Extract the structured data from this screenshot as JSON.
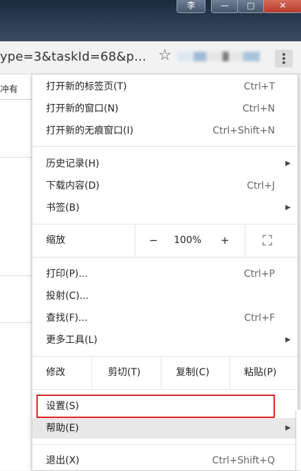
{
  "window": {
    "user_badge": "李",
    "minimize": "—",
    "maximize": "□",
    "close": "✕"
  },
  "toolbar": {
    "url": "ype=3&taskId=68&p...",
    "bookmark_icon": "star-icon",
    "menu_icon": "more-vert-icon"
  },
  "page": {
    "tab_text": "冲有"
  },
  "menu": {
    "new_tab": {
      "label": "打开新的标签页(T)",
      "shortcut": "Ctrl+T"
    },
    "new_window": {
      "label": "打开新的窗口(N)",
      "shortcut": "Ctrl+N"
    },
    "incognito": {
      "label": "打开新的无痕窗口(I)",
      "shortcut": "Ctrl+Shift+N"
    },
    "history": {
      "label": "历史记录(H)"
    },
    "downloads": {
      "label": "下载内容(D)",
      "shortcut": "Ctrl+J"
    },
    "bookmarks": {
      "label": "书签(B)"
    },
    "zoom": {
      "label": "缩放",
      "minus": "−",
      "value": "100%",
      "plus": "+",
      "fullscreen": "⛶"
    },
    "print": {
      "label": "打印(P)...",
      "shortcut": "Ctrl+P"
    },
    "cast": {
      "label": "投射(C)..."
    },
    "find": {
      "label": "查找(F)...",
      "shortcut": "Ctrl+F"
    },
    "more_tools": {
      "label": "更多工具(L)"
    },
    "edit": {
      "label": "修改",
      "cut": "剪切(T)",
      "copy": "复制(C)",
      "paste": "粘贴(P)"
    },
    "settings": {
      "label": "设置(S)"
    },
    "help": {
      "label": "帮助(E)"
    },
    "exit": {
      "label": "退出(X)",
      "shortcut": "Ctrl+Shift+Q"
    },
    "submenu_arrow": "▶"
  },
  "colors": {
    "highlight_border": "#e02020",
    "hover_bg": "#e8e8e8"
  }
}
